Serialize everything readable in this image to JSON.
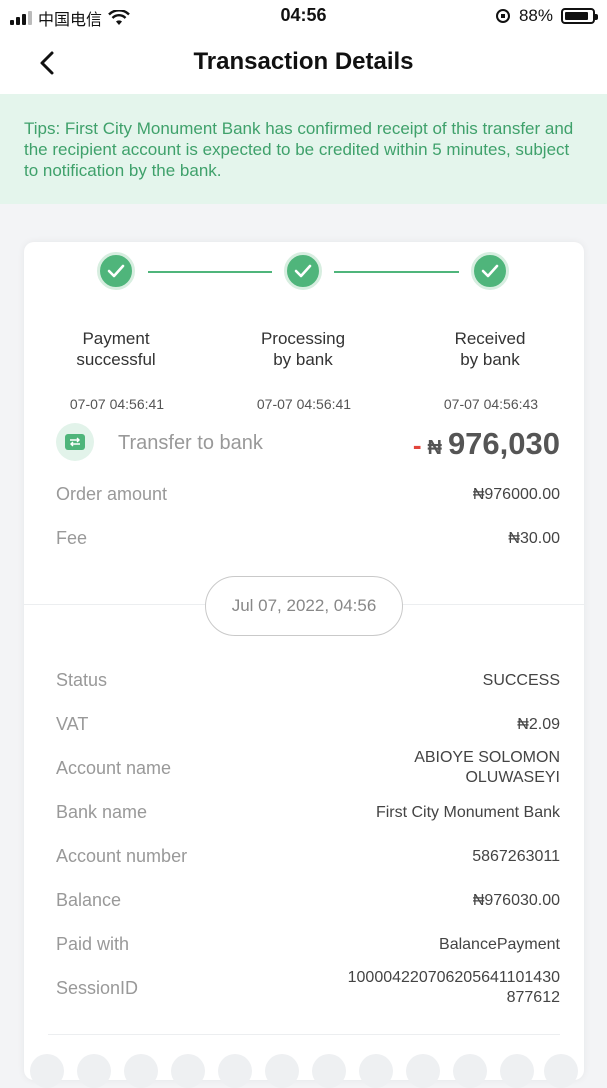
{
  "status_bar": {
    "carrier": "中国电信",
    "time": "04:56",
    "battery": "88%"
  },
  "header": {
    "title": "Transaction Details"
  },
  "tips": {
    "text": "Tips: First City Monument Bank has confirmed receipt of this transfer and the recipient account is expected to be credited within 5 minutes, subject to notification by the bank."
  },
  "steps": [
    {
      "line1": "Payment",
      "line2": "successful",
      "time": "07-07 04:56:41"
    },
    {
      "line1": "Processing",
      "line2": "by bank",
      "time": "07-07 04:56:41"
    },
    {
      "line1": "Received",
      "line2": "by bank",
      "time": "07-07 04:56:43"
    }
  ],
  "transaction": {
    "label": "Transfer to bank",
    "sign": "-",
    "currency": "₦",
    "amount": "976,030"
  },
  "order_amount": {
    "label": "Order amount",
    "value": "₦976000.00"
  },
  "fee": {
    "label": "Fee",
    "value": "₦30.00"
  },
  "date": "Jul 07, 2022, 04:56",
  "details": {
    "status": {
      "label": "Status",
      "value": "SUCCESS"
    },
    "vat": {
      "label": "VAT",
      "value": "₦2.09"
    },
    "account_name": {
      "label": "Account name",
      "value_line1": "ABIOYE SOLOMON",
      "value_line2": "OLUWASEYI"
    },
    "bank_name": {
      "label": "Bank name",
      "value": "First City Monument Bank"
    },
    "account_number": {
      "label": "Account number",
      "value": "5867263011"
    },
    "balance": {
      "label": "Balance",
      "value": "₦976030.00"
    },
    "paid_with": {
      "label": "Paid with",
      "value": "BalancePayment"
    },
    "session_id": {
      "label": "SessionID",
      "value_line1": "100004220706205641101430",
      "value_line2": "877612"
    }
  },
  "colors": {
    "accent_green": "#4fb57b",
    "tips_bg": "#e4f5ec",
    "minus_red": "#e2453c"
  }
}
